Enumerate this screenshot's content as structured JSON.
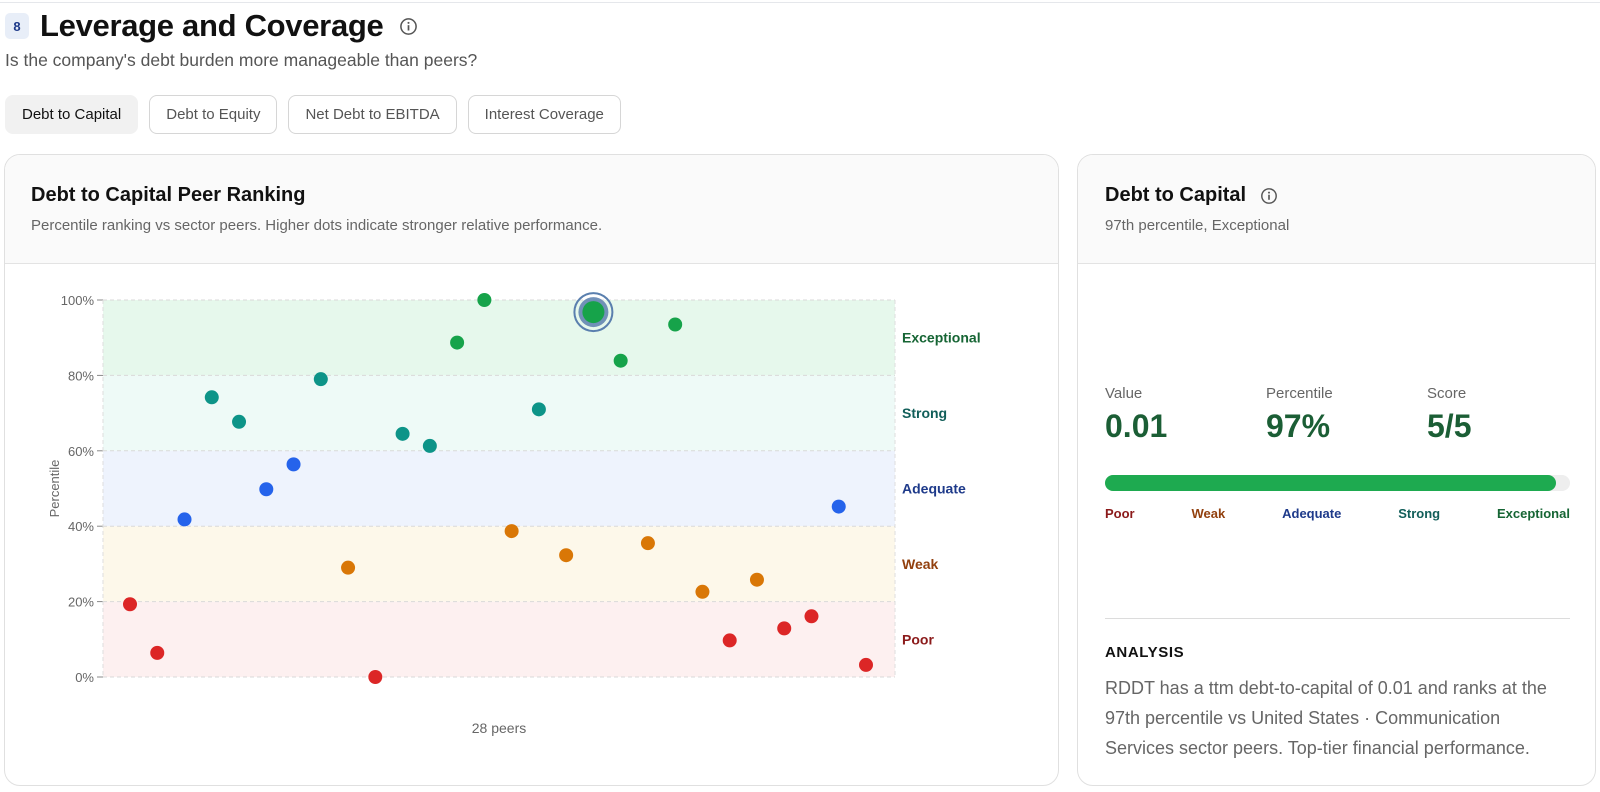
{
  "section": {
    "number": "8",
    "title": "Leverage and Coverage",
    "subtitle": "Is the company's debt burden more manageable than peers?"
  },
  "tabs": [
    {
      "label": "Debt to Capital",
      "active": true
    },
    {
      "label": "Debt to Equity",
      "active": false
    },
    {
      "label": "Net Debt to EBITDA",
      "active": false
    },
    {
      "label": "Interest Coverage",
      "active": false
    }
  ],
  "chart_card": {
    "title": "Debt to Capital Peer Ranking",
    "description": "Percentile ranking vs sector peers. Higher dots indicate stronger relative performance."
  },
  "colors": {
    "Poor": "#dc2626",
    "Weak": "#d97706",
    "Adequate": "#2563eb",
    "Strong": "#0d9488",
    "Exceptional": "#16a34a",
    "label_Poor": "#8b1a1a",
    "label_Weak": "#92400e",
    "label_Adequate": "#1e3a8a",
    "label_Strong": "#115e59",
    "label_Exceptional": "#166534",
    "highlight_ring": "#5a7fae"
  },
  "chart_data": {
    "type": "scatter",
    "title": "",
    "xlabel": "28 peers",
    "ylabel": "Percentile",
    "ylim": [
      0,
      100
    ],
    "y_ticks": [
      "0%",
      "20%",
      "40%",
      "60%",
      "80%",
      "100%"
    ],
    "bands": [
      {
        "name": "Exceptional",
        "from": 80,
        "to": 100
      },
      {
        "name": "Strong",
        "from": 60,
        "to": 80
      },
      {
        "name": "Adequate",
        "from": 40,
        "to": 60
      },
      {
        "name": "Weak",
        "from": 20,
        "to": 40
      },
      {
        "name": "Poor",
        "from": 0,
        "to": 20
      }
    ],
    "points": [
      {
        "rank": 1,
        "percentile": 19.3,
        "band": "Poor"
      },
      {
        "rank": 2,
        "percentile": 6.4,
        "band": "Poor"
      },
      {
        "rank": 3,
        "percentile": 41.8,
        "band": "Adequate"
      },
      {
        "rank": 4,
        "percentile": 74.2,
        "band": "Strong"
      },
      {
        "rank": 5,
        "percentile": 67.7,
        "band": "Strong"
      },
      {
        "rank": 6,
        "percentile": 49.8,
        "band": "Adequate"
      },
      {
        "rank": 7,
        "percentile": 56.4,
        "band": "Adequate"
      },
      {
        "rank": 8,
        "percentile": 79.0,
        "band": "Strong"
      },
      {
        "rank": 9,
        "percentile": 29.0,
        "band": "Weak"
      },
      {
        "rank": 10,
        "percentile": 0.0,
        "band": "Poor"
      },
      {
        "rank": 11,
        "percentile": 64.5,
        "band": "Strong"
      },
      {
        "rank": 12,
        "percentile": 61.3,
        "band": "Strong"
      },
      {
        "rank": 13,
        "percentile": 88.7,
        "band": "Exceptional"
      },
      {
        "rank": 14,
        "percentile": 100.0,
        "band": "Exceptional"
      },
      {
        "rank": 15,
        "percentile": 38.7,
        "band": "Weak"
      },
      {
        "rank": 16,
        "percentile": 71.0,
        "band": "Strong"
      },
      {
        "rank": 17,
        "percentile": 32.3,
        "band": "Weak"
      },
      {
        "rank": 18,
        "percentile": 96.8,
        "band": "Exceptional",
        "highlight": true
      },
      {
        "rank": 19,
        "percentile": 83.9,
        "band": "Exceptional"
      },
      {
        "rank": 20,
        "percentile": 35.5,
        "band": "Weak"
      },
      {
        "rank": 21,
        "percentile": 93.5,
        "band": "Exceptional"
      },
      {
        "rank": 22,
        "percentile": 22.6,
        "band": "Weak"
      },
      {
        "rank": 23,
        "percentile": 9.7,
        "band": "Poor"
      },
      {
        "rank": 24,
        "percentile": 25.8,
        "band": "Weak"
      },
      {
        "rank": 25,
        "percentile": 12.9,
        "band": "Poor"
      },
      {
        "rank": 26,
        "percentile": 16.1,
        "band": "Poor"
      },
      {
        "rank": 27,
        "percentile": 45.2,
        "band": "Adequate"
      },
      {
        "rank": 28,
        "percentile": 3.2,
        "band": "Poor"
      }
    ],
    "grid": true
  },
  "detail_card": {
    "title": "Debt to Capital",
    "summary": "97th percentile, Exceptional",
    "metrics": [
      {
        "label": "Value",
        "value": "0.01"
      },
      {
        "label": "Percentile",
        "value": "97%"
      },
      {
        "label": "Score",
        "value": "5/5"
      }
    ],
    "progress_percent": 97,
    "scale_labels": [
      "Poor",
      "Weak",
      "Adequate",
      "Strong",
      "Exceptional"
    ],
    "analysis_heading": "ANALYSIS",
    "analysis_text": "RDDT has a ttm debt-to-capital of 0.01 and ranks at the 97th percentile vs United States · Communication Services sector peers. Top-tier financial performance."
  }
}
